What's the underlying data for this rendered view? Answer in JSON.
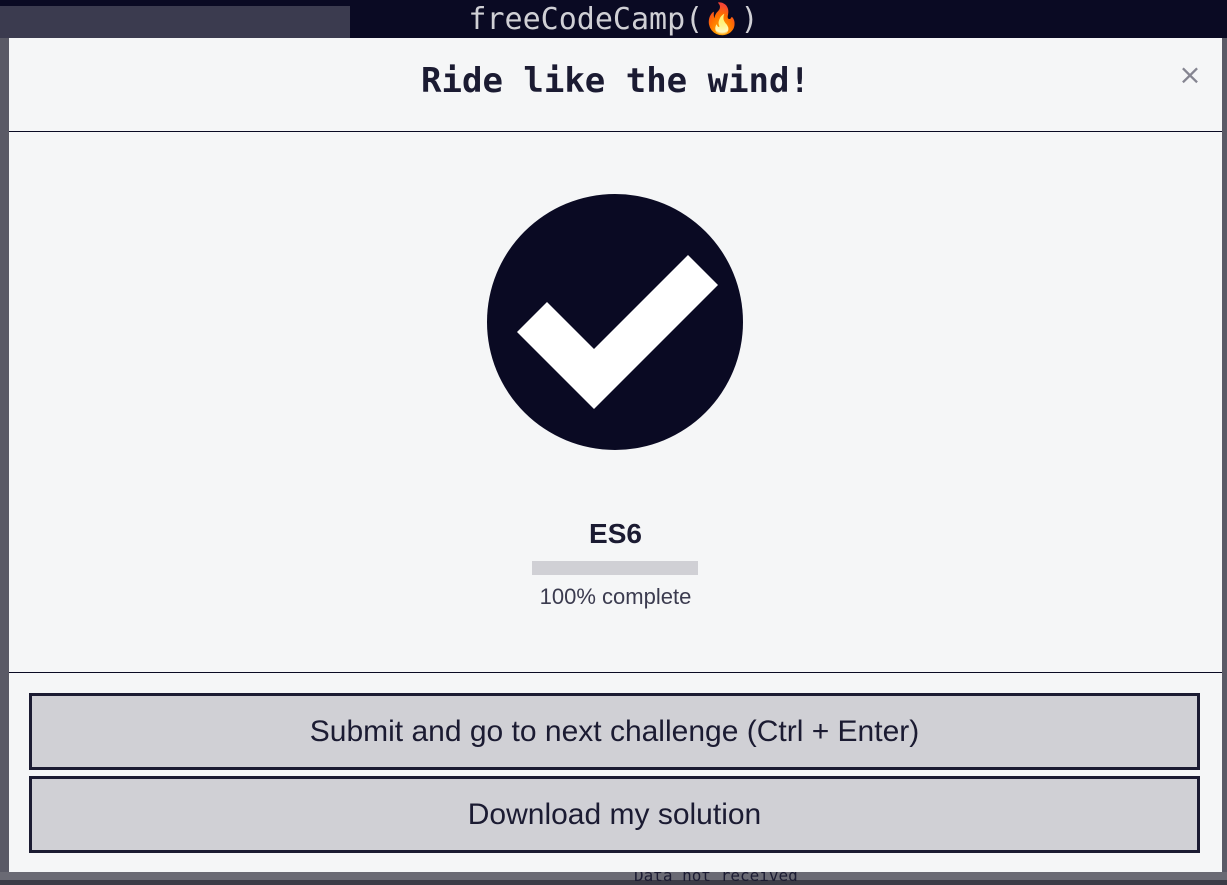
{
  "nav": {
    "brand": "freeCodeCamp(🔥)"
  },
  "background": {
    "console_text": "Data not received"
  },
  "modal": {
    "title": "Ride like the wind!",
    "close_label": "×",
    "icon": "check-circle-icon",
    "block_name": "ES6",
    "progress_percent": 100,
    "progress_label": "100% complete",
    "submit_label": "Submit and go to next challenge (Ctrl + Enter)",
    "download_label": "Download my solution"
  },
  "colors": {
    "nav_bg": "#0a0a23",
    "modal_bg": "#f5f6f7",
    "accent_dark": "#0a0a23",
    "button_bg": "#d0d0d5",
    "text_dark": "#1b1b32"
  }
}
